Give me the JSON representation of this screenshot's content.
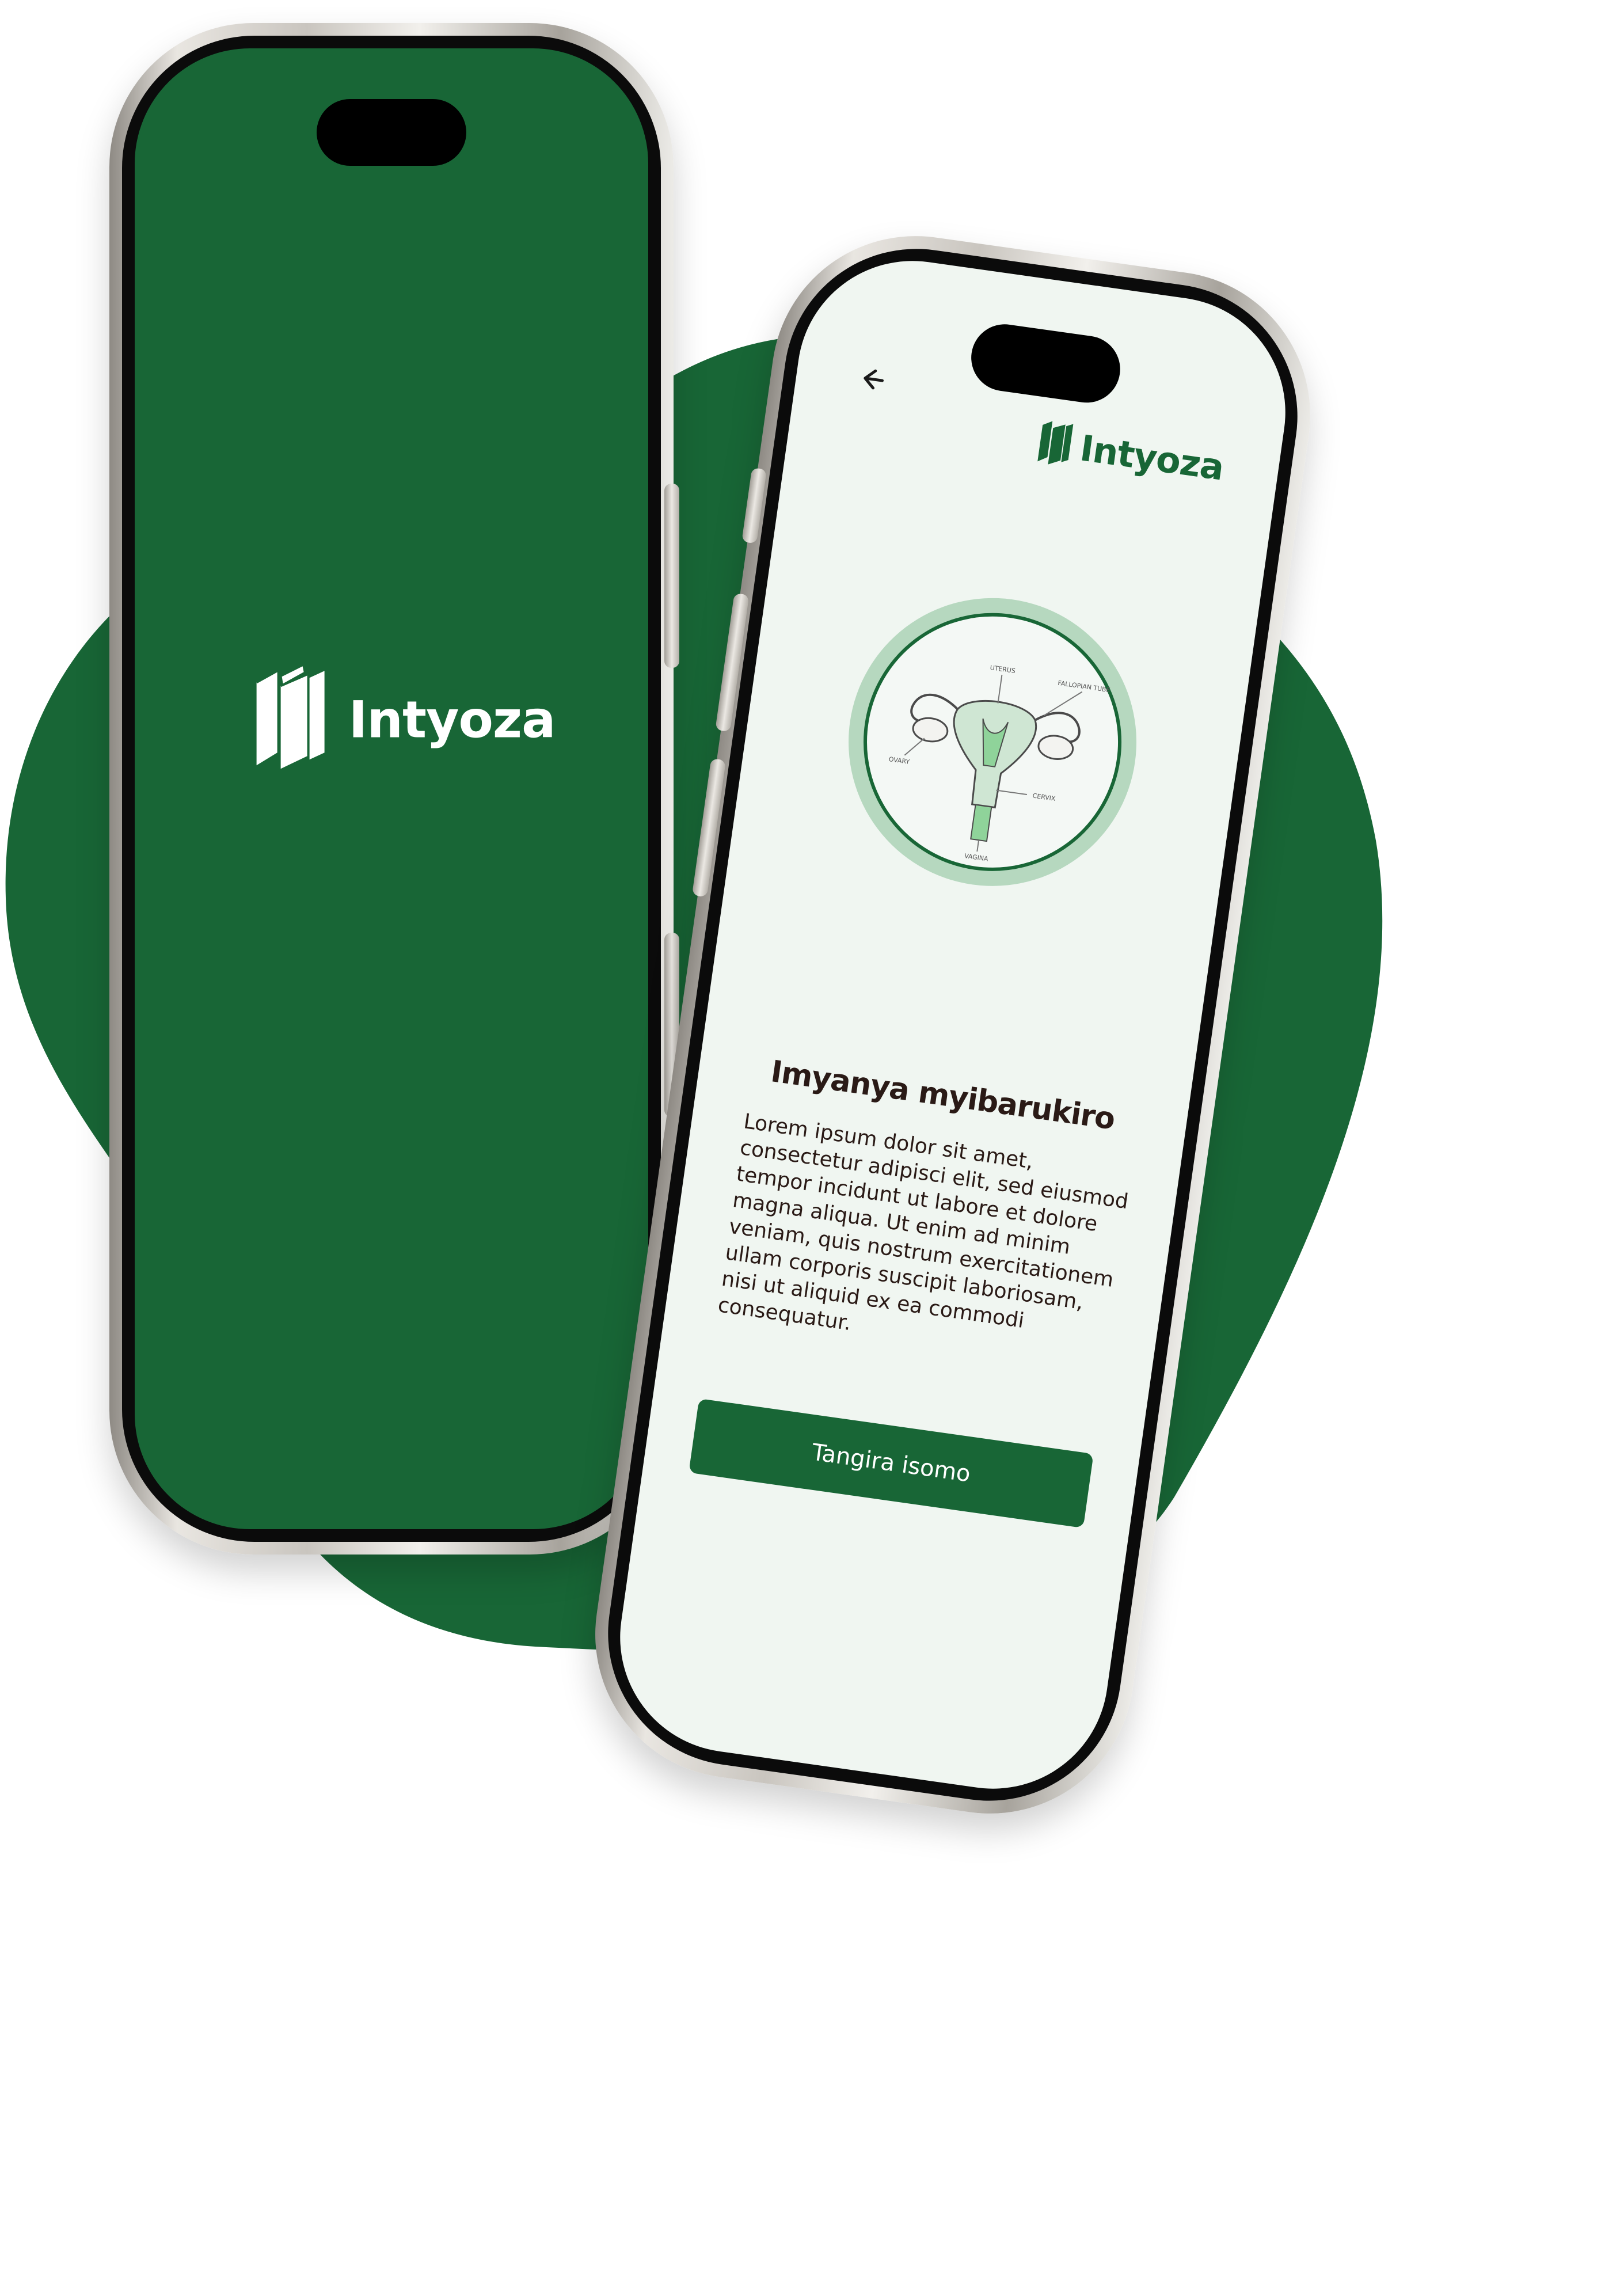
{
  "brand": {
    "name": "Intyoza",
    "primary_color": "#186636",
    "light_bg_color": "#f0f6f1",
    "text_color": "#2a1a16",
    "logo_icon": "books-icon"
  },
  "splash_screen": {
    "logo_text": "Intyoza"
  },
  "lesson_screen": {
    "back_icon": "arrow-left-icon",
    "header_logo_text": "Intyoza",
    "illustration": {
      "icon": "uterus-diagram-icon",
      "labels": [
        "UTERUS",
        "FALLOPIAN TUBE",
        "OVARY",
        "CERVIX",
        "VAGINA"
      ]
    },
    "title": "Imyanya myibarukiro",
    "body": "Lorem ipsum dolor sit amet, consectetur adipisci elit, sed eiusmod tempor incidunt ut labore et dolore magna aliqua. Ut enim ad minim veniam, quis nostrum exercitationem ullam corporis suscipit laboriosam, nisi ut aliquid ex ea commodi consequatur.",
    "start_button_label": "Tangira isomo"
  }
}
